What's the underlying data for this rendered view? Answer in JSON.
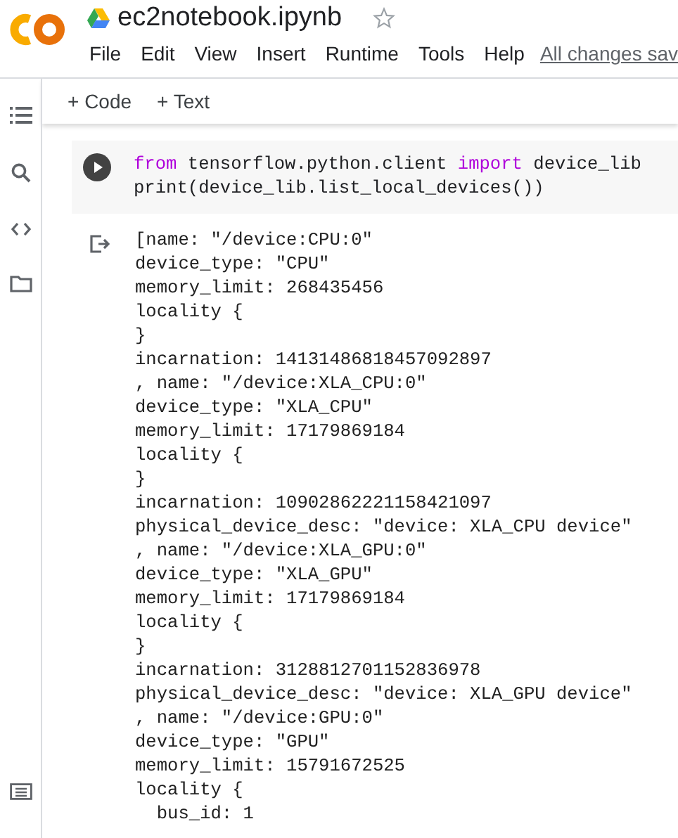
{
  "header": {
    "title": "ec2notebook.ipynb",
    "starred": false,
    "menu": [
      "File",
      "Edit",
      "View",
      "Insert",
      "Runtime",
      "Tools",
      "Help"
    ],
    "save_status": "All changes sav"
  },
  "toolbar": {
    "buttons": [
      "+ Code",
      "+ Text"
    ]
  },
  "sidebar": {
    "items": [
      {
        "kind": "toc"
      },
      {
        "kind": "search"
      },
      {
        "kind": "snippets"
      },
      {
        "kind": "files"
      }
    ],
    "bottom": {
      "kind": "terminal"
    }
  },
  "cell": {
    "code": [
      [
        {
          "kind": "keyword",
          "text": "from"
        },
        {
          "kind": "plain",
          "text": " tensorflow.python.client "
        },
        {
          "kind": "keyword",
          "text": "import"
        },
        {
          "kind": "plain",
          "text": " device_lib"
        }
      ],
      [
        {
          "kind": "plain",
          "text": "print(device_lib.list_local_devices())"
        }
      ]
    ],
    "output": [
      "[name: \"/device:CPU:0\"",
      "device_type: \"CPU\"",
      "memory_limit: 268435456",
      "locality {",
      "}",
      "incarnation: 14131486818457092897",
      ", name: \"/device:XLA_CPU:0\"",
      "device_type: \"XLA_CPU\"",
      "memory_limit: 17179869184",
      "locality {",
      "}",
      "incarnation: 10902862221158421097",
      "physical_device_desc: \"device: XLA_CPU device\"",
      ", name: \"/device:XLA_GPU:0\"",
      "device_type: \"XLA_GPU\"",
      "memory_limit: 17179869184",
      "locality {",
      "}",
      "incarnation: 3128812701152836978",
      "physical_device_desc: \"device: XLA_GPU device\"",
      ", name: \"/device:GPU:0\"",
      "device_type: \"GPU\"",
      "memory_limit: 15791672525",
      "locality {",
      "  bus_id: 1"
    ]
  }
}
